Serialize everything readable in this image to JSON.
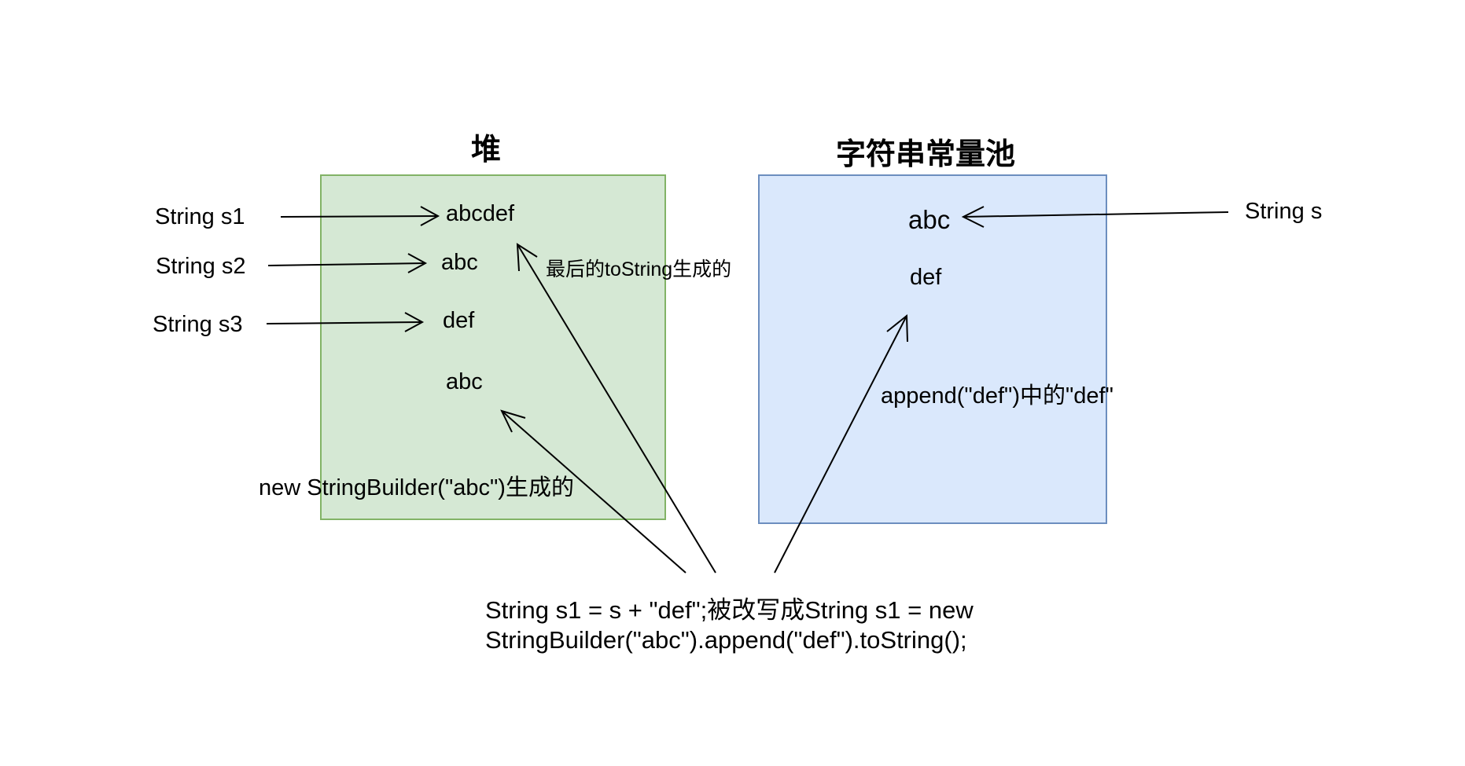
{
  "heap": {
    "title": "堆",
    "values": [
      "abcdef",
      "abc",
      "def",
      "abc"
    ],
    "fill": "#d5e8d4",
    "stroke": "#82b366"
  },
  "pool": {
    "title": "字符串常量池",
    "values": [
      "abc",
      "def"
    ],
    "fill": "#dae8fc",
    "stroke": "#6c8ebf"
  },
  "refs": {
    "s1": "String s1",
    "s2": "String s2",
    "s3": "String s3",
    "s": "String s"
  },
  "notes": {
    "tostring": "最后的toString生成的",
    "append": "append(\"def\")中的\"def\"",
    "builder": "new StringBuilder(\"abc\")生成的"
  },
  "code": {
    "line1": "String s1 = s + \"def\";被改写成String s1 = new",
    "line2": "StringBuilder(\"abc\").append(\"def\").toString();"
  }
}
